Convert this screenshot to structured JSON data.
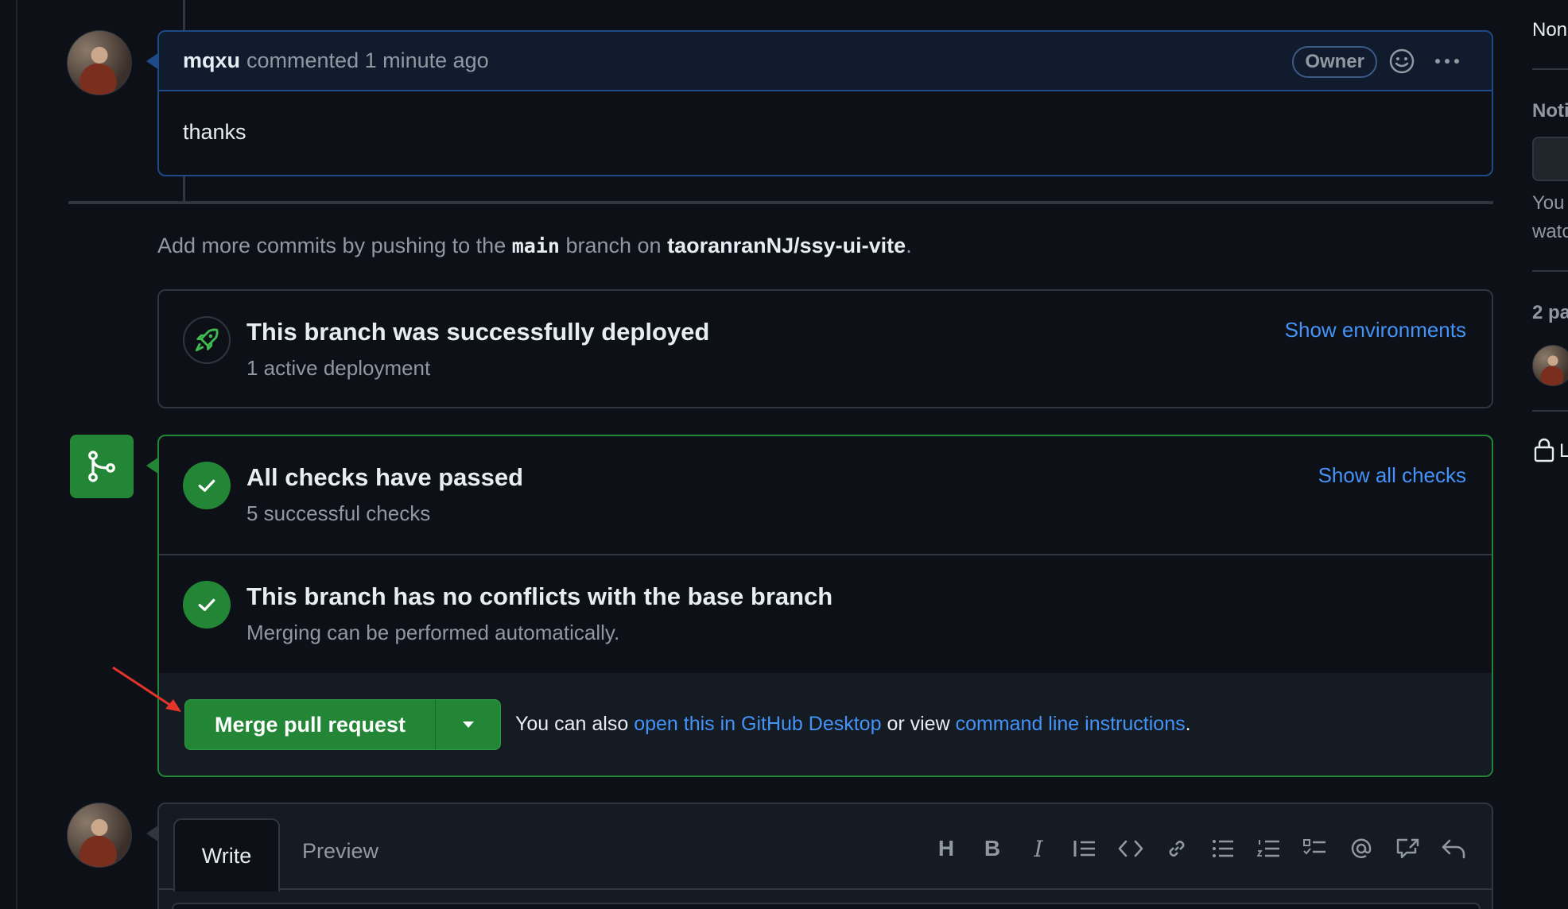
{
  "comment": {
    "author": "mqxu",
    "meta": "commented 1 minute ago",
    "badge": "Owner",
    "body": "thanks"
  },
  "push_hint": {
    "prefix": "Add more commits by pushing to the",
    "branch": "main",
    "middle": "branch on",
    "repo": "taoranranNJ/ssy-ui-vite",
    "suffix": "."
  },
  "deployment": {
    "title": "This branch was successfully deployed",
    "subtitle": "1 active deployment",
    "link": "Show environments"
  },
  "checks": {
    "title": "All checks have passed",
    "subtitle": "5 successful checks",
    "link": "Show all checks"
  },
  "conflicts": {
    "title": "This branch has no conflicts with the base branch",
    "subtitle": "Merging can be performed automatically."
  },
  "merge": {
    "button_label": "Merge pull request",
    "note_prefix": "You can also",
    "desktop_link": "open this in GitHub Desktop",
    "note_middle": "or view",
    "cli_link": "command line instructions",
    "note_suffix": "."
  },
  "editor": {
    "tab_write": "Write",
    "tab_preview": "Preview",
    "toolbar": [
      "heading-icon",
      "bold-icon",
      "italic-icon",
      "quote-icon",
      "code-icon",
      "link-icon",
      "bulleted-list-icon",
      "numbered-list-icon",
      "task-list-icon",
      "mention-icon",
      "cross-reference-icon",
      "reply-icon"
    ]
  },
  "sidebar": {
    "item1": "Non",
    "item2": "Noti",
    "item3": "You",
    "item4": "watc",
    "item5": "2 pa",
    "item6": "L"
  },
  "colors": {
    "background": "#0d1117",
    "accent_green": "#238636",
    "link_blue": "#4493f8",
    "comment_border": "#1f4a8a"
  }
}
